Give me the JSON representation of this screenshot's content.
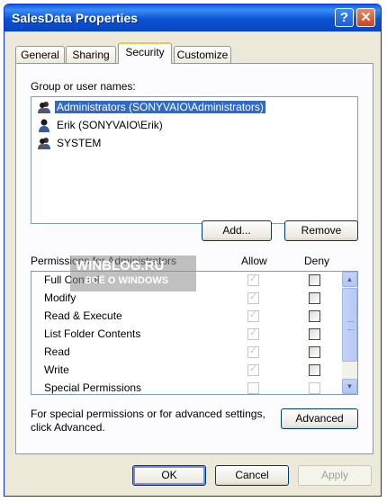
{
  "window": {
    "title": "SalesData Properties",
    "help_glyph": "?",
    "close_glyph": "✕"
  },
  "tabs": [
    {
      "label": "General"
    },
    {
      "label": "Sharing"
    },
    {
      "label": "Security",
      "active": true
    },
    {
      "label": "Customize"
    }
  ],
  "groups": {
    "label": "Group or user names:",
    "items": [
      {
        "name": "Administrators (SONYVAIO\\Administrators)",
        "icon": "group-icon",
        "selected": true
      },
      {
        "name": "Erik (SONYVAIO\\Erik)",
        "icon": "user-icon"
      },
      {
        "name": "SYSTEM",
        "icon": "group-icon"
      }
    ],
    "add_label": "Add...",
    "remove_label": "Remove"
  },
  "permissions": {
    "label": "Permissions for Administrators",
    "allow_header": "Allow",
    "deny_header": "Deny",
    "rows": [
      {
        "name": "Full Control"
      },
      {
        "name": "Modify"
      },
      {
        "name": "Read & Execute"
      },
      {
        "name": "List Folder Contents"
      },
      {
        "name": "Read"
      },
      {
        "name": "Write"
      },
      {
        "name": "Special Permissions"
      }
    ]
  },
  "advanced": {
    "text_line1": "For special permissions or for advanced settings,",
    "text_line2": "click Advanced.",
    "button_label": "Advanced"
  },
  "footer": {
    "ok_label": "OK",
    "cancel_label": "Cancel",
    "apply_label": "Apply"
  },
  "watermark": {
    "line1": "WINBLOG.RU",
    "line2": "ВСЁ О WINDOWS"
  },
  "colors": {
    "titlebar": "#0a52d0",
    "selection": "#316ac5",
    "dialog": "#ece9d8"
  }
}
